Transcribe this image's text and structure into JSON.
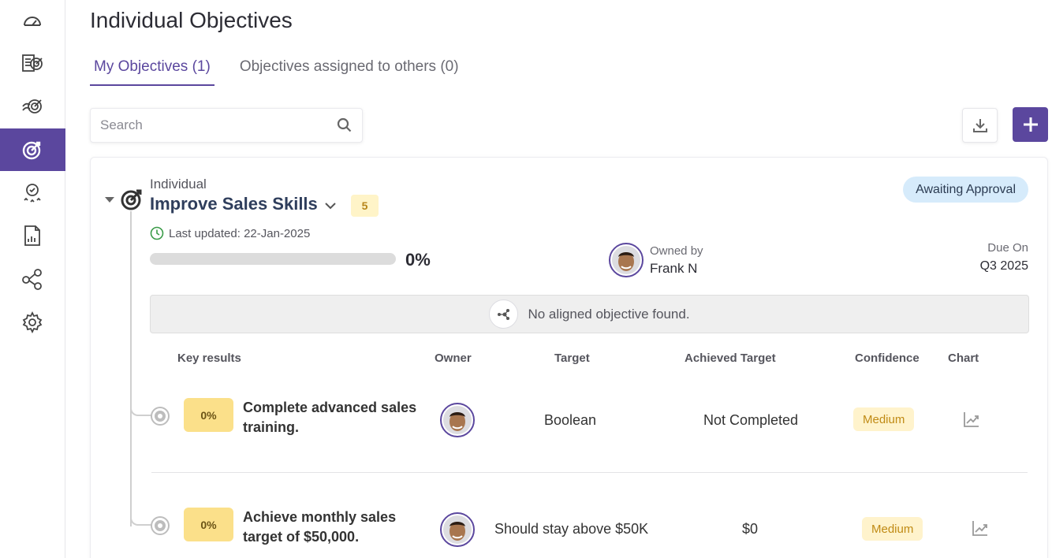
{
  "page": {
    "title": "Individual Objectives"
  },
  "tabs": [
    {
      "label": "My Objectives (1)",
      "active": true
    },
    {
      "label": "Objectives assigned to others (0)",
      "active": false
    }
  ],
  "search": {
    "placeholder": "Search"
  },
  "sidebar": {
    "items": [
      {
        "icon": "dashboard-icon",
        "active": false
      },
      {
        "icon": "objectives-list-icon",
        "active": false
      },
      {
        "icon": "team-objectives-icon",
        "active": false
      },
      {
        "icon": "target-icon",
        "active": true
      },
      {
        "icon": "reviews-award-icon",
        "active": false
      },
      {
        "icon": "report-icon",
        "active": false
      },
      {
        "icon": "alignment-tree-icon",
        "active": false
      },
      {
        "icon": "settings-icon",
        "active": false
      }
    ]
  },
  "objective": {
    "type": "Individual",
    "title": "Improve Sales Skills",
    "key_result_count": "5",
    "status": "Awaiting Approval",
    "last_updated": "Last updated: 22-Jan-2025",
    "progress": 0,
    "progress_label": "0%",
    "owned_by_label": "Owned by",
    "owner_name": "Frank N",
    "due_label": "Due On",
    "due_value": "Q3 2025",
    "aligned_text": "No aligned objective found."
  },
  "columns": {
    "key_results": "Key results",
    "owner": "Owner",
    "target": "Target",
    "achieved": "Achieved Target",
    "confidence": "Confidence",
    "chart": "Chart"
  },
  "key_results": [
    {
      "progress": "0%",
      "title": "Complete advanced sales training.",
      "target": "Boolean",
      "achieved": "Not Completed",
      "confidence": "Medium"
    },
    {
      "progress": "0%",
      "title": "Achieve monthly sales target of $50,000.",
      "target": "Should stay above $50K",
      "achieved": "$0",
      "confidence": "Medium"
    }
  ],
  "colors": {
    "accent": "#5b479e",
    "status_bg": "#d6ebfb",
    "badge_yellow": "#fff4c8",
    "progress_pill": "#fbe08a"
  }
}
